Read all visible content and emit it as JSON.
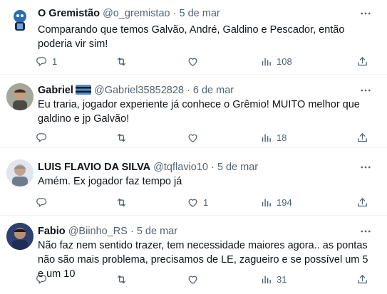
{
  "tweets": [
    {
      "name": "O Gremistão",
      "handle": "@o_gremistao",
      "dot": "·",
      "date": "5 de mar",
      "text": "Comparando que temos Galvão, André, Galdino e Pescador, então poderia vir  sim!",
      "replies": "1",
      "retweets": "",
      "likes": "",
      "views": "108"
    },
    {
      "name": "Gabriel",
      "handle": "@Gabriel35852828",
      "dot": "·",
      "date": "6 de mar",
      "text": "Eu traria, jogador experiente já conhece o Grêmio! MUITO melhor que galdino e jp Galvão!",
      "replies": "",
      "retweets": "",
      "likes": "",
      "views": "18"
    },
    {
      "name": "LUIS FLAVIO DA SILVA",
      "handle": "@tqflavio10",
      "dot": "·",
      "date": "5 de mar",
      "text": "Amém. Ex jogador faz tempo já",
      "replies": "",
      "retweets": "",
      "likes": "1",
      "views": "194"
    },
    {
      "name": "Fabio",
      "handle": "@Biinho_RS",
      "dot": "·",
      "date": "5 de mar",
      "text": "Não faz nem sentido trazer, tem necessidade maiores agora.. as pontas não são mais problema, precisamos de LE, zagueiro e se possível um 5 e um 10",
      "replies": "",
      "retweets": "",
      "likes": "",
      "views": "31"
    }
  ],
  "icons": {
    "reply": "reply-icon",
    "retweet": "retweet-icon",
    "like": "heart-icon",
    "views": "views-icon",
    "share": "share-icon",
    "more": "more-icon"
  },
  "colors": {
    "text": "#0f1419",
    "muted": "#536471",
    "divider": "#eff3f4"
  }
}
